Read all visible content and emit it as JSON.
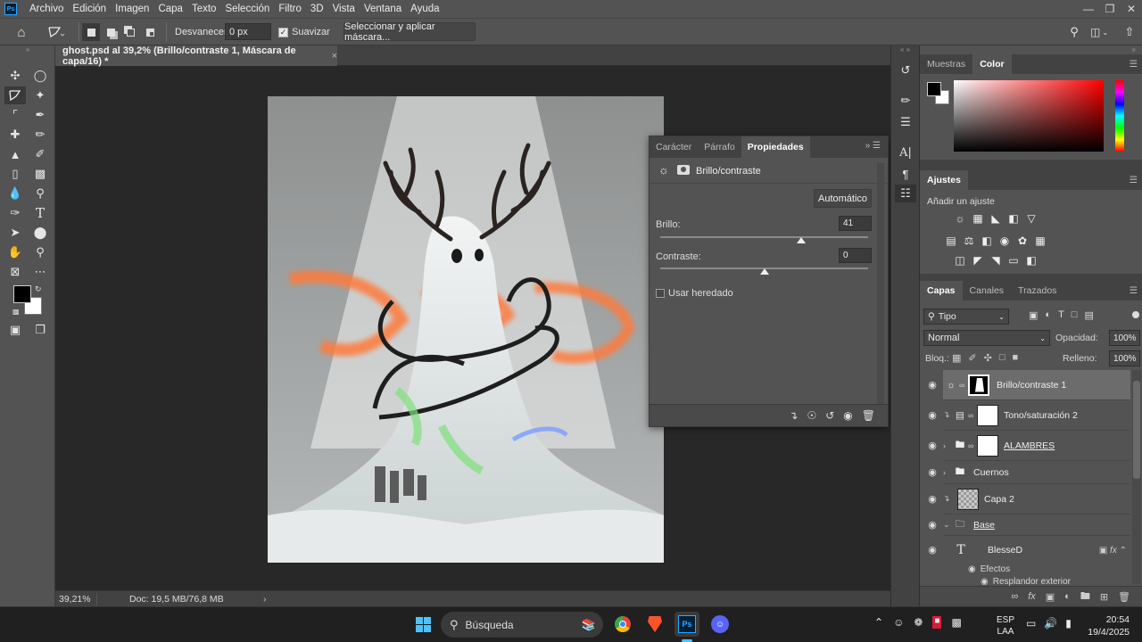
{
  "app": {
    "logo": "Ps"
  },
  "menu": [
    "Archivo",
    "Edición",
    "Imagen",
    "Capa",
    "Texto",
    "Selección",
    "Filtro",
    "3D",
    "Vista",
    "Ventana",
    "Ayuda"
  ],
  "window_controls": [
    "minimize-icon",
    "restore-icon",
    "close-icon"
  ],
  "options_bar": {
    "feather_label": "Desvanecer:",
    "feather_value": "0 px",
    "antialias_label": "Suavizar",
    "antialias_checked": true,
    "select_mask_button": "Seleccionar y aplicar máscara..."
  },
  "document": {
    "tab_title": "ghost.psd al 39,2% (Brillo/contraste 1, Máscara de capa/16) *",
    "zoom": "39,21%",
    "doc_info": "Doc: 19,5 MB/76,8 MB"
  },
  "properties_panel": {
    "tabs": [
      "Carácter",
      "Párrafo",
      "Propiedades"
    ],
    "active_tab": "Propiedades",
    "title": "Brillo/contraste",
    "auto_button": "Automático",
    "brightness_label": "Brillo:",
    "brightness_value": "41",
    "brightness_fraction": 0.68,
    "contrast_label": "Contraste:",
    "contrast_value": "0",
    "contrast_fraction": 0.5,
    "legacy_label": "Usar heredado",
    "legacy_checked": false
  },
  "swatches_panel": {
    "tabs": [
      "Muestras",
      "Color"
    ],
    "active_tab": "Color",
    "hue_color": "#ff0000"
  },
  "adjustments_panel": {
    "title": "Ajustes",
    "subtitle": "Añadir un ajuste"
  },
  "layers_panel": {
    "tabs": [
      "Capas",
      "Canales",
      "Trazados"
    ],
    "active_tab": "Capas",
    "filter_kind": "Tipo",
    "blend_mode": "Normal",
    "opacity_label": "Opacidad:",
    "opacity_value": "100%",
    "lock_label": "Bloq.:",
    "fill_label": "Relleno:",
    "fill_value": "100%",
    "layers": [
      {
        "name": "Brillo/contraste 1",
        "selected": true
      },
      {
        "name": "Tono/saturación 2",
        "selected": false
      },
      {
        "name": "ALAMBRES",
        "selected": false
      },
      {
        "name": "Cuernos",
        "selected": false
      },
      {
        "name": "Capa 2",
        "selected": false
      },
      {
        "name": "Base",
        "selected": false
      },
      {
        "name": "BlesseD",
        "selected": false
      }
    ],
    "effects_label": "Efectos",
    "effect_name": "Resplandor exterior"
  },
  "taskbar": {
    "search_placeholder": "Búsqueda",
    "lang_top": "ESP",
    "lang_bottom": "LAA",
    "time": "20:54",
    "date": "19/4/2025"
  },
  "colors": {
    "accent": "#31a8ff",
    "fg_swatch": "#000000",
    "bg_swatch": "#ffffff"
  }
}
